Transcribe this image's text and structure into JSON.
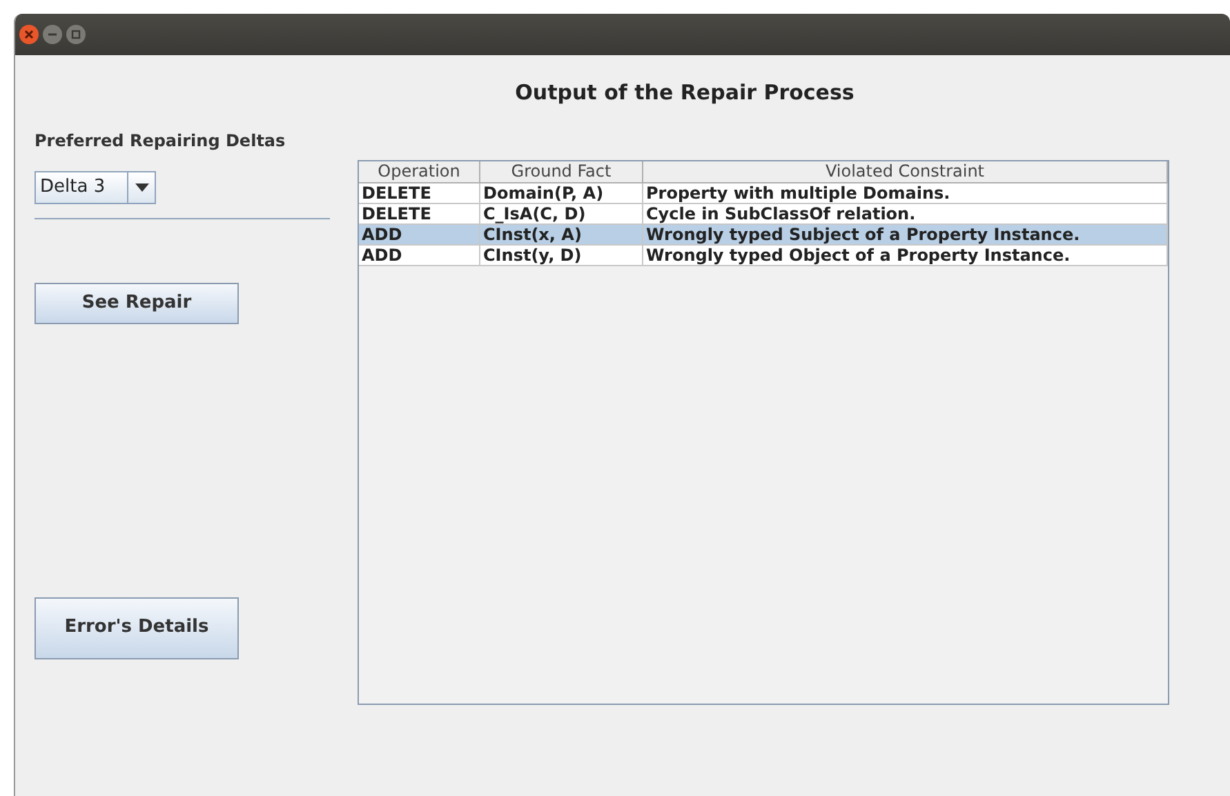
{
  "title": "Output of the Repair Process",
  "deltas_label": "Preferred Repairing Deltas",
  "delta_combo": {
    "value": "Delta 3"
  },
  "buttons": [
    "See Repair",
    "Error's Details"
  ],
  "table": {
    "columns": [
      "Operation",
      "Ground Fact",
      "Violated Constraint"
    ],
    "rows": [
      {
        "cells": [
          "DELETE",
          "Domain(P, A)",
          "Property with multiple Domains."
        ],
        "selected": false
      },
      {
        "cells": [
          "DELETE",
          "C_IsA(C, D)",
          "Cycle in SubClassOf relation."
        ],
        "selected": false
      },
      {
        "cells": [
          "ADD",
          "CInst(x, A)",
          "Wrongly typed Subject of a Property Instance."
        ],
        "selected": true
      },
      {
        "cells": [
          "ADD",
          "CInst(y, D)",
          "Wrongly typed Object of a Property Instance."
        ],
        "selected": false
      }
    ]
  }
}
